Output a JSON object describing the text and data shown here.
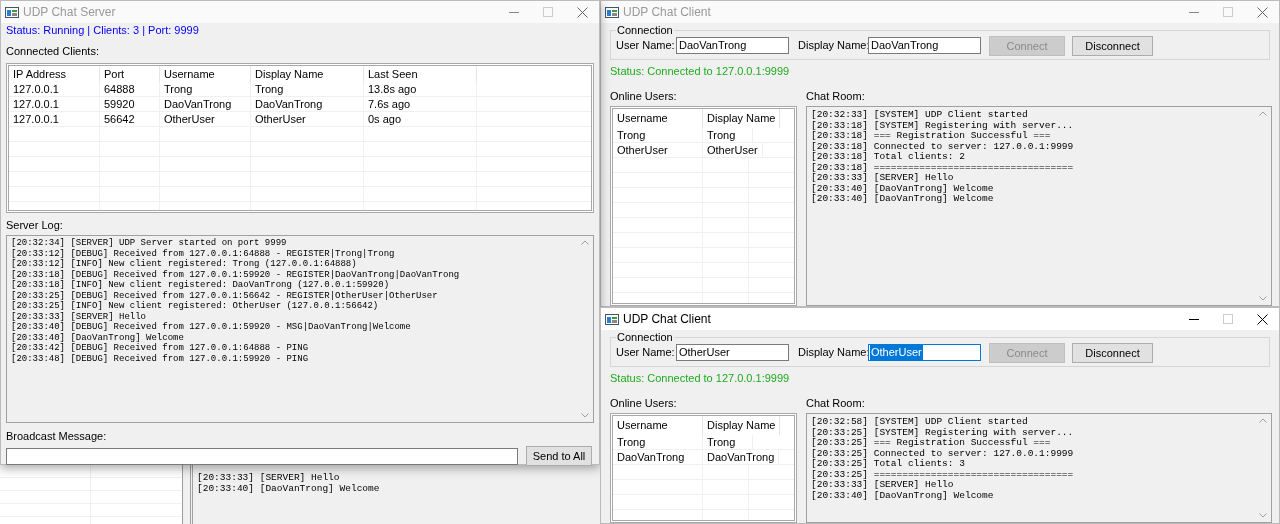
{
  "server_window": {
    "title": "UDP Chat Server",
    "active": false,
    "status": "Status: Running | Clients: 3 | Port: 9999",
    "clients_label": "Connected Clients:",
    "clients_table": {
      "columns": [
        "IP Address",
        "Port",
        "Username",
        "Display Name",
        "Last Seen"
      ],
      "rows": [
        [
          "127.0.0.1",
          "64888",
          "Trong",
          "Trong",
          "13.8s ago"
        ],
        [
          "127.0.0.1",
          "59920",
          "DaoVanTrong",
          "DaoVanTrong",
          "7.6s ago"
        ],
        [
          "127.0.0.1",
          "56642",
          "OtherUser",
          "OtherUser",
          "0s ago"
        ]
      ]
    },
    "log_label": "Server Log:",
    "log": [
      "[20:32:34] [SERVER] UDP Server started on port 9999",
      "[20:33:12] [DEBUG] Received from 127.0.0.1:64888 - REGISTER|Trong|Trong",
      "[20:33:12] [INFO] New client registered: Trong (127.0.0.1:64888)",
      "[20:33:18] [DEBUG] Received from 127.0.0.1:59920 - REGISTER|DaoVanTrong|DaoVanTrong",
      "[20:33:18] [INFO] New client registered: DaoVanTrong (127.0.0.1:59920)",
      "[20:33:25] [DEBUG] Received from 127.0.0.1:56642 - REGISTER|OtherUser|OtherUser",
      "[20:33:25] [INFO] New client registered: OtherUser (127.0.0.1:56642)",
      "[20:33:33] [SERVER] Hello",
      "[20:33:40] [DEBUG] Received from 127.0.0.1:59920 - MSG|DaoVanTrong|Welcome",
      "[20:33:40] [DaoVanTrong] Welcome",
      "[20:33:42] [DEBUG] Received from 127.0.0.1:64888 - PING",
      "[20:33:48] [DEBUG] Received from 127.0.0.1:59920 - PING"
    ],
    "broadcast_label": "Broadcast Message:",
    "send_button": "Send to All"
  },
  "client_windows": [
    {
      "title": "UDP Chat Client",
      "active": false,
      "connection_label": "Connection",
      "user_name_label": "User Name:",
      "user_name": "DaoVanTrong",
      "display_name_label": "Display Name:",
      "display_name": {
        "value": "DaoVanTrong",
        "selected": false
      },
      "connect_button": {
        "label": "Connect",
        "disabled": true
      },
      "disconnect_button": {
        "label": "Disconnect",
        "disabled": false
      },
      "status": "Status: Connected to 127.0.0.1:9999",
      "online_users_label": "Online Users:",
      "users_table": {
        "columns": [
          "Username",
          "Display Name"
        ],
        "rows": [
          [
            "Trong",
            "Trong"
          ],
          [
            "OtherUser",
            "OtherUser"
          ]
        ]
      },
      "chat_label": "Chat Room:",
      "chat": [
        "[20:32:33] [SYSTEM] UDP Client started",
        "[20:33:18] [SYSTEM] Registering with server...",
        "[20:33:18] === Registration Successful ===",
        "[20:33:18] Connected to server: 127.0.0.1:9999",
        "[20:33:18] Total clients: 2",
        "[20:33:18] ===================================",
        "[20:33:33] [SERVER] Hello",
        "[20:33:40] [DaoVanTrong] Welcome",
        "[20:33:40] [DaoVanTrong] Welcome"
      ]
    },
    {
      "title": "UDP Chat Client",
      "active": true,
      "connection_label": "Connection",
      "user_name_label": "User Name:",
      "user_name": "OtherUser",
      "display_name_label": "Display Name:",
      "display_name": {
        "value": "OtherUser",
        "selected": true
      },
      "connect_button": {
        "label": "Connect",
        "disabled": true
      },
      "disconnect_button": {
        "label": "Disconnect",
        "disabled": false
      },
      "status": "Status: Connected to 127.0.0.1:9999",
      "online_users_label": "Online Users:",
      "users_table": {
        "columns": [
          "Username",
          "Display Name"
        ],
        "rows": [
          [
            "Trong",
            "Trong"
          ],
          [
            "DaoVanTrong",
            "DaoVanTrong"
          ]
        ]
      },
      "chat_label": "Chat Room:",
      "chat": [
        "[20:32:58] [SYSTEM] UDP Client started",
        "[20:33:25] [SYSTEM] Registering with server...",
        "[20:33:25] === Registration Successful ===",
        "[20:33:25] Connected to server: 127.0.0.1:9999",
        "[20:33:25] Total clients: 3",
        "[20:33:25] ===================================",
        "[20:33:33] [SERVER] Hello",
        "[20:33:40] [DaoVanTrong] Welcome"
      ]
    }
  ],
  "background_window": {
    "chat": [
      "[20:33:33] [SERVER] Hello",
      "[20:33:40] [DaoVanTrong] Welcome"
    ]
  }
}
